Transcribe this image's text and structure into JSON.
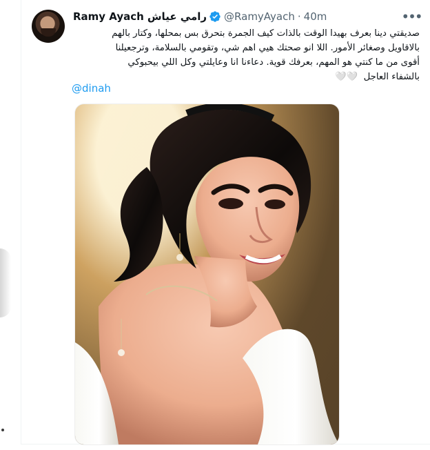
{
  "tweet": {
    "display_name": "Ramy Ayach",
    "display_name_ar": "رامي عياش",
    "handle": "@RamyAyach",
    "separator": "·",
    "timestamp": "40m",
    "more_label": "•••",
    "lines": [
      "صديقتي دينا بعرف بهيدا الوقت بالذات كيف الجمرة بتحرق بس بمحلها، وكتار بالهم",
      "بالاقاويل وصغائر الأمور. اللا انو صحتك هيي اهم شي، وتقومي بالسلامة، وترجعيلنا",
      "أقوى من ما كنتي هو المهم، بعرفك قوية. دعاءنا انا وعايلتي وكل اللي بيحبوكي",
      "بالشفاء العاجل"
    ],
    "heart_emoji": "🤍🤍",
    "mention": "@dinah",
    "accent_color": "#1d9bf0",
    "verified_color": "#1d9bf0"
  },
  "media": {
    "alt": "Portrait photo of a woman"
  },
  "icons": {
    "verified": "verified-badge-icon",
    "more": "more-options-icon"
  }
}
